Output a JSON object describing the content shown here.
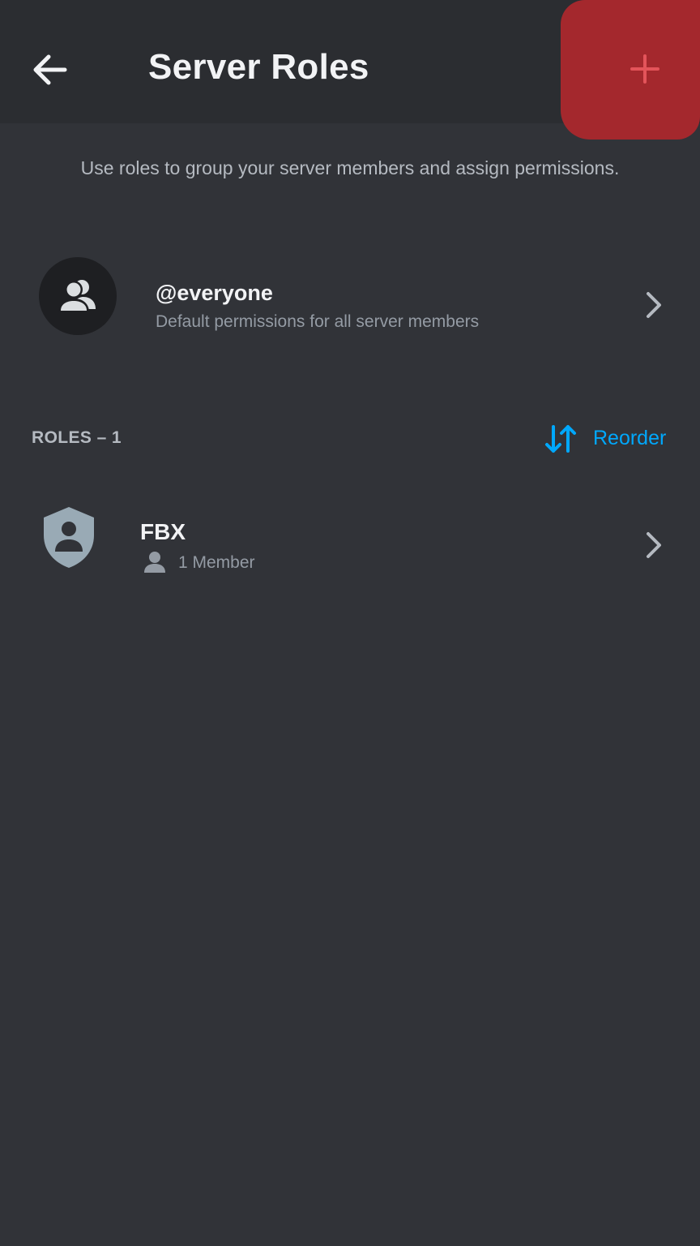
{
  "header": {
    "title": "Server Roles",
    "back_icon": "arrow-left-icon",
    "add_icon": "plus-icon",
    "add_button_color": "#a4282d"
  },
  "description": "Use roles to group your server members and assign permissions.",
  "everyone": {
    "name": "@everyone",
    "subtitle": "Default permissions for all server members",
    "icon": "people-icon"
  },
  "roles_section": {
    "header": "ROLES – 1",
    "reorder_label": "Reorder",
    "reorder_icon": "sort-arrows-icon",
    "accent_color": "#00a8fc"
  },
  "roles": [
    {
      "name": "FBX",
      "members_label": "1 Member",
      "icon": "shield-person-icon",
      "color": "#99aab5"
    }
  ]
}
